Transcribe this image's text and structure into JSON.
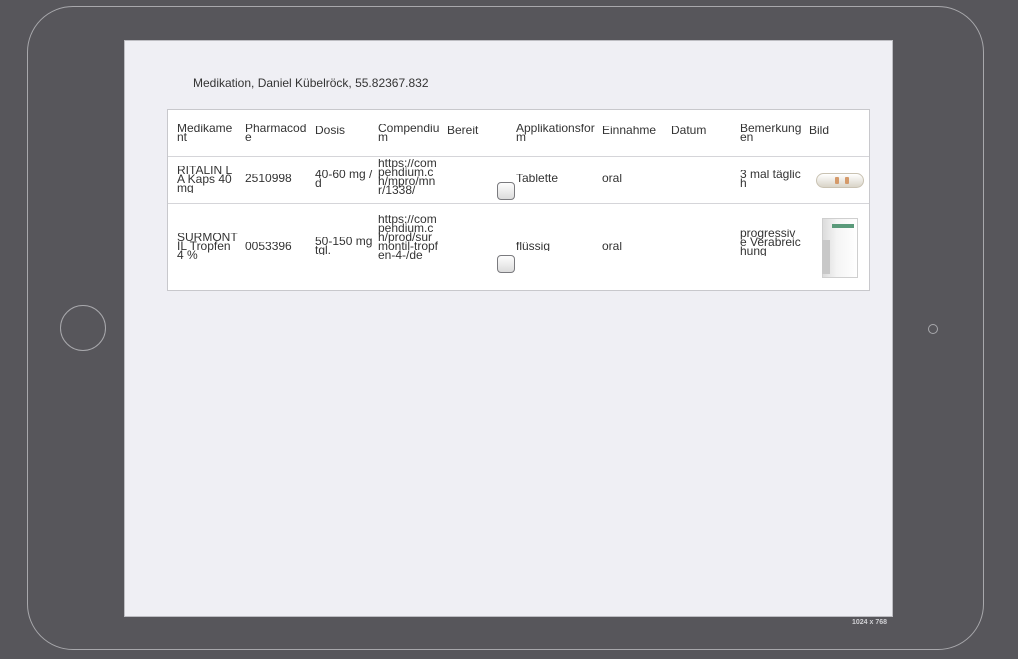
{
  "screen": {
    "title": "Medikation, Daniel Kübelröck, 55.82367.832",
    "resolution_label": "1024 x 768"
  },
  "table": {
    "headers": {
      "medication": "Medikament",
      "pharmacode": "Pharmacode",
      "dose": "Dosis",
      "compendium": "Compendium",
      "ready": "Bereit",
      "application_form": "Applikationsform",
      "intake": "Einnahme",
      "date": "Datum",
      "remark": "Bemerkungen",
      "image": "Bild"
    },
    "rows": [
      {
        "medication": "RITALIN LA Kaps 40 mg",
        "pharmacode": "2510998",
        "dose": "40-60 mg /d",
        "compendium": "https://compendium.ch/mpro/mnr/1338/",
        "ready": false,
        "application_form": "Tablette",
        "intake": "oral",
        "date": "",
        "remark": "3 mal täglich",
        "image": "capsule-image"
      },
      {
        "medication": "SURMONTIL Tropfen 4 %",
        "pharmacode": "0053396",
        "dose": "50-150 mg tgl.",
        "compendium": "https://compendium.ch/prod/surmontil-tropfen-4-/de",
        "ready": false,
        "application_form": "flüssig",
        "intake": "oral",
        "date": "",
        "remark": "progressive Verabreichung",
        "image": "medicine-box-image"
      }
    ]
  }
}
